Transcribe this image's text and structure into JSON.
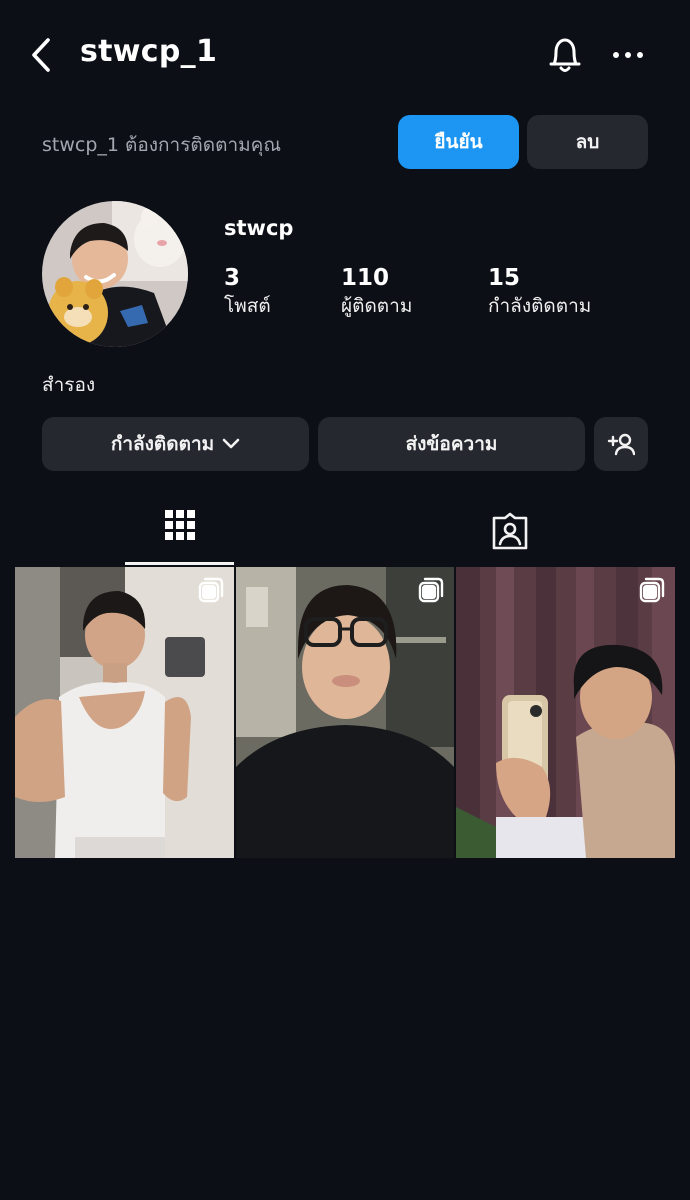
{
  "header": {
    "title": "stwcp_1",
    "back_icon": "chevron-left-icon",
    "bell_icon": "bell-icon",
    "more_icon": "more-horizontal-icon"
  },
  "follow_request": {
    "text": "stwcp_1 ต้องการติดตามคุณ",
    "confirm_label": "ยืนยัน",
    "delete_label": "ลบ"
  },
  "profile": {
    "name": "stwcp",
    "posts_count": "3",
    "posts_label": "โพสต์",
    "followers_count": "110",
    "followers_label": "ผู้ติดตาม",
    "following_count": "15",
    "following_label": "กำลังติดตาม",
    "bio": "สำรอง"
  },
  "actions": {
    "following_label": "กำลังติดตาม",
    "message_label": "ส่งข้อความ",
    "suggest_icon": "add-person-icon"
  },
  "tabs": [
    {
      "name": "grid",
      "icon": "grid-icon",
      "active": true
    },
    {
      "name": "tagged",
      "icon": "tagged-user-icon",
      "active": false
    }
  ],
  "posts": [
    {
      "kind": "carousel"
    },
    {
      "kind": "carousel"
    },
    {
      "kind": "carousel"
    }
  ],
  "colors": {
    "background": "#0d0f17",
    "primary_button": "#1c96f2",
    "secondary_button": "#262830",
    "muted_text": "#a3a6ae"
  }
}
